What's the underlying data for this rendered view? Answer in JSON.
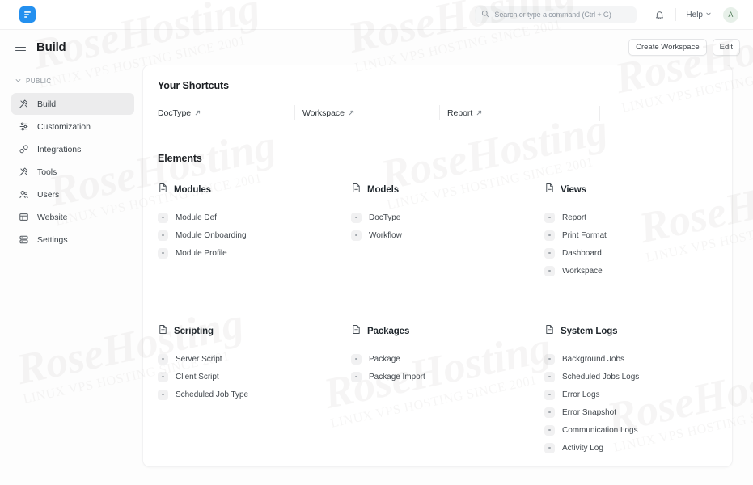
{
  "navbar": {
    "logo_icon": "frappe-logo-icon",
    "search": {
      "icon": "search-icon",
      "placeholder": "Search or type a command (Ctrl + G)",
      "value": ""
    },
    "notifications_icon": "bell-icon",
    "help_label": "Help",
    "help_chevron_icon": "chevron-down-icon",
    "avatar_initial": "A"
  },
  "page_header": {
    "menu_icon": "hamburger-menu-icon",
    "title": "Build",
    "create_workspace_label": "Create Workspace",
    "edit_label": "Edit"
  },
  "sidebar": {
    "section_label": "PUBLIC",
    "section_chevron_icon": "chevron-down-icon",
    "items": [
      {
        "label": "Build",
        "icon": "tools-icon",
        "active": true
      },
      {
        "label": "Customization",
        "icon": "sliders-icon",
        "active": false
      },
      {
        "label": "Integrations",
        "icon": "puzzle-icon",
        "active": false
      },
      {
        "label": "Tools",
        "icon": "tools-icon",
        "active": false
      },
      {
        "label": "Users",
        "icon": "users-icon",
        "active": false
      },
      {
        "label": "Website",
        "icon": "browser-icon",
        "active": false
      },
      {
        "label": "Settings",
        "icon": "server-icon",
        "active": false
      }
    ]
  },
  "main": {
    "shortcuts": {
      "title": "Your Shortcuts",
      "items": [
        {
          "label": "DocType",
          "icon": "arrow-up-right-icon"
        },
        {
          "label": "Workspace",
          "icon": "arrow-up-right-icon"
        },
        {
          "label": "Report",
          "icon": "arrow-up-right-icon"
        }
      ]
    },
    "elements": {
      "title": "Elements",
      "groups": [
        {
          "title": "Modules",
          "icon": "document-icon",
          "links": [
            "Module Def",
            "Module Onboarding",
            "Module Profile"
          ]
        },
        {
          "title": "Models",
          "icon": "document-icon",
          "links": [
            "DocType",
            "Workflow"
          ]
        },
        {
          "title": "Views",
          "icon": "document-icon",
          "links": [
            "Report",
            "Print Format",
            "Dashboard",
            "Workspace"
          ]
        },
        {
          "title": "Scripting",
          "icon": "document-icon",
          "links": [
            "Server Script",
            "Client Script",
            "Scheduled Job Type"
          ]
        },
        {
          "title": "Packages",
          "icon": "document-icon",
          "links": [
            "Package",
            "Package Import"
          ]
        },
        {
          "title": "System Logs",
          "icon": "document-icon",
          "links": [
            "Background Jobs",
            "Scheduled Jobs Logs",
            "Error Logs",
            "Error Snapshot",
            "Communication Logs",
            "Activity Log"
          ]
        }
      ]
    }
  },
  "watermark": {
    "text": "RoseHosting",
    "subtext": "LINUX VPS HOSTING SINCE 2001"
  },
  "colors": {
    "brand_blue": "#2490ef",
    "page_bg": "#fdfdfd",
    "card_bg": "#ffffff",
    "active_sidebar": "#ececed",
    "text_primary": "#1c1f23",
    "text_secondary": "#41474d",
    "text_muted": "#8b939b",
    "avatar_bg": "#e7f0e9"
  }
}
